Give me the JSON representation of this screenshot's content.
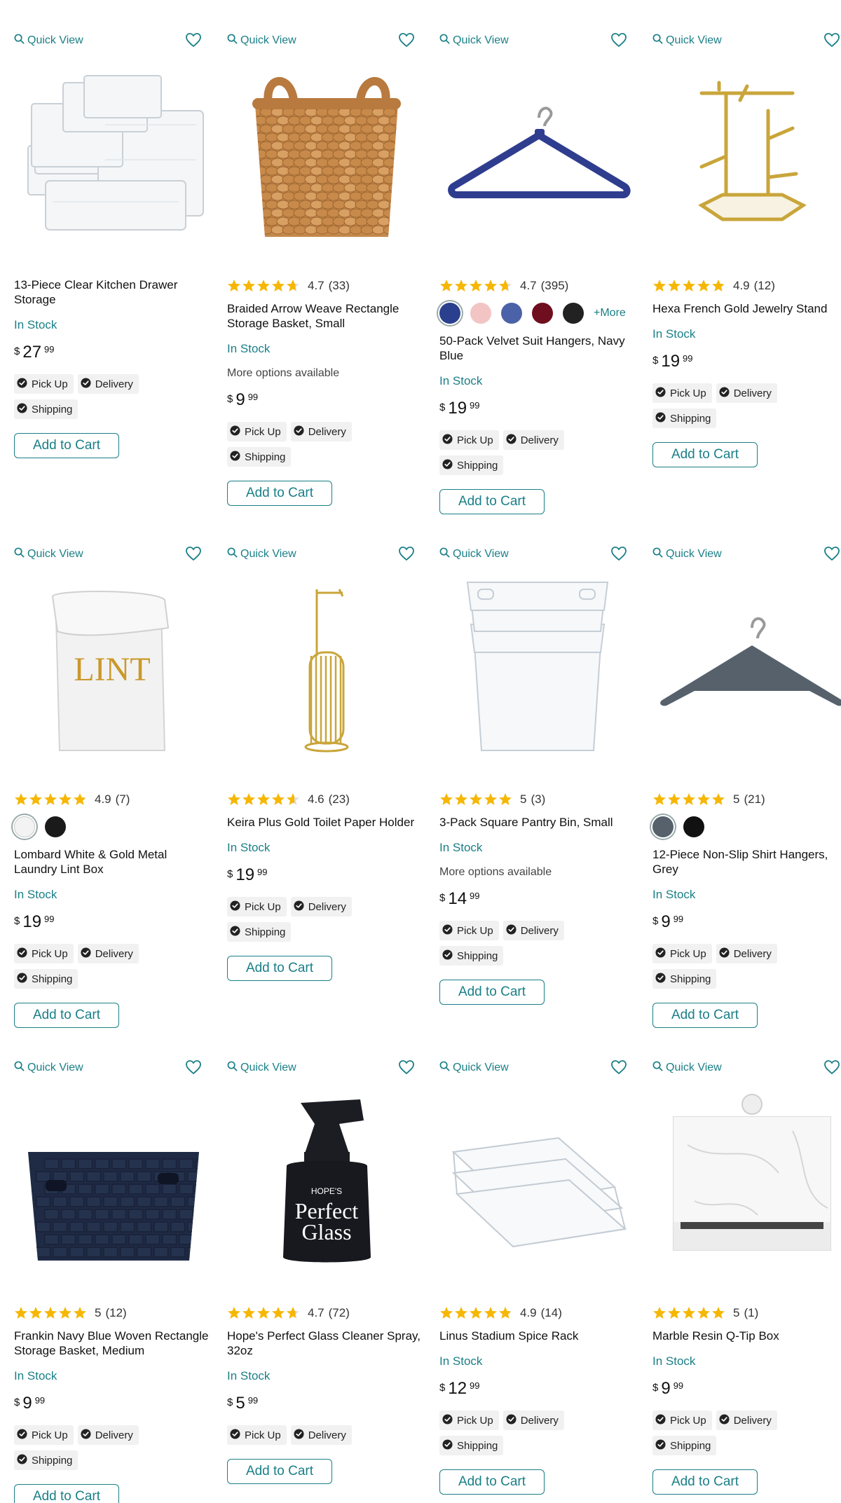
{
  "ui": {
    "quick_view": "Quick View",
    "more_options": "More options available",
    "currency": "$",
    "add_to_cart": "Add to Cart",
    "colors": {
      "teal": "#1a7f87",
      "star": "#f6b704",
      "tag_bg": "#f1f1f1"
    }
  },
  "products": [
    {
      "title": "13-Piece Clear Kitchen Drawer Storage",
      "rating": null,
      "swatches": [],
      "stock": "In Stock",
      "options": "",
      "price_dollars": "27",
      "price_cents": "99",
      "tags": [
        "Pick Up",
        "Delivery",
        "Shipping"
      ]
    },
    {
      "title": "Braided Arrow Weave Rectangle Storage Basket, Small",
      "rating": "4.7",
      "count": "(33)",
      "stars": 4.7,
      "swatches": [],
      "stock": "In Stock",
      "options": "More options available",
      "price_dollars": "9",
      "price_cents": "99",
      "tags": [
        "Pick Up",
        "Delivery",
        "Shipping"
      ]
    },
    {
      "title": "50-Pack Velvet Suit Hangers, Navy Blue",
      "rating": "4.7",
      "count": "(395)",
      "stars": 4.7,
      "swatches": [
        "#2b3f8f",
        "#f2c4c4",
        "#4b62a8",
        "#6e0e1e",
        "#222222"
      ],
      "more": "+More",
      "stock": "In Stock",
      "options": "",
      "price_dollars": "19",
      "price_cents": "99",
      "tags": [
        "Pick Up",
        "Delivery",
        "Shipping"
      ]
    },
    {
      "title": "Hexa French Gold Jewelry Stand",
      "rating": "4.9",
      "count": "(12)",
      "stars": 4.9,
      "swatches": [],
      "stock": "In Stock",
      "options": "",
      "price_dollars": "19",
      "price_cents": "99",
      "tags": [
        "Pick Up",
        "Delivery",
        "Shipping"
      ]
    },
    {
      "title": "Lombard White & Gold Metal Laundry Lint Box",
      "rating": "4.9",
      "count": "(7)",
      "stars": 4.9,
      "swatches": [
        "#f3f3f3",
        "#1a1a1a"
      ],
      "stock": "In Stock",
      "options": "",
      "price_dollars": "19",
      "price_cents": "99",
      "tags": [
        "Pick Up",
        "Delivery",
        "Shipping"
      ]
    },
    {
      "title": "Keira Plus Gold Toilet Paper Holder",
      "rating": "4.6",
      "count": "(23)",
      "stars": 4.6,
      "swatches": [],
      "stock": "In Stock",
      "options": "",
      "price_dollars": "19",
      "price_cents": "99",
      "tags": [
        "Pick Up",
        "Delivery",
        "Shipping"
      ]
    },
    {
      "title": "3-Pack Square Pantry Bin, Small",
      "rating": "5",
      "count": "(3)",
      "stars": 5,
      "swatches": [],
      "stock": "In Stock",
      "options": "More options available",
      "price_dollars": "14",
      "price_cents": "99",
      "tags": [
        "Pick Up",
        "Delivery",
        "Shipping"
      ]
    },
    {
      "title": "12-Piece Non-Slip Shirt Hangers, Grey",
      "rating": "5",
      "count": "(21)",
      "stars": 5,
      "swatches": [
        "#56616c",
        "#111111"
      ],
      "stock": "In Stock",
      "options": "",
      "price_dollars": "9",
      "price_cents": "99",
      "tags": [
        "Pick Up",
        "Delivery",
        "Shipping"
      ]
    },
    {
      "title": "Frankin Navy Blue Woven Rectangle Storage Basket, Medium",
      "rating": "5",
      "count": "(12)",
      "stars": 5,
      "swatches": [],
      "stock": "In Stock",
      "options": "",
      "price_dollars": "9",
      "price_cents": "99",
      "tags": [
        "Pick Up",
        "Delivery",
        "Shipping"
      ]
    },
    {
      "title": "Hope's Perfect Glass Cleaner Spray, 32oz",
      "rating": "4.7",
      "count": "(72)",
      "stars": 4.7,
      "swatches": [],
      "stock": "In Stock",
      "options": "",
      "price_dollars": "5",
      "price_cents": "99",
      "tags": [
        "Pick Up",
        "Delivery"
      ]
    },
    {
      "title": "Linus Stadium Spice Rack",
      "rating": "4.9",
      "count": "(14)",
      "stars": 4.9,
      "swatches": [],
      "stock": "In Stock",
      "options": "",
      "price_dollars": "12",
      "price_cents": "99",
      "tags": [
        "Pick Up",
        "Delivery",
        "Shipping"
      ]
    },
    {
      "title": "Marble Resin Q-Tip Box",
      "rating": "5",
      "count": "(1)",
      "stars": 5,
      "swatches": [],
      "stock": "In Stock",
      "options": "",
      "price_dollars": "9",
      "price_cents": "99",
      "tags": [
        "Pick Up",
        "Delivery",
        "Shipping"
      ]
    }
  ],
  "images": [
    "clear-drawer-organizers",
    "woven-basket",
    "navy-velvet-hanger",
    "gold-jewelry-stand",
    "lint-box",
    "gold-toilet-paper-holder",
    "clear-pantry-bins",
    "grey-shirt-hanger",
    "navy-woven-basket",
    "glass-cleaner-bottle",
    "clear-spice-rack",
    "marble-qtip-box"
  ],
  "lint_label": "LINT",
  "cleaner_label": {
    "brand": "HOPE'S",
    "line1": "Perfect",
    "line2": "Glass"
  }
}
